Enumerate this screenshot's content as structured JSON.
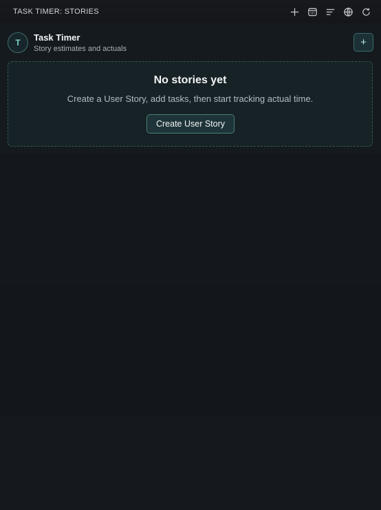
{
  "window": {
    "title": "TASK TIMER: STORIES",
    "toolbar_icons": [
      "plus-icon",
      "calendar-icon",
      "list-icon",
      "globe-icon",
      "refresh-icon"
    ]
  },
  "header": {
    "avatar_letter": "T",
    "title": "Task Timer",
    "subtitle": "Story estimates and actuals",
    "add_label": "+"
  },
  "empty_state": {
    "title": "No stories yet",
    "message": "Create a User Story, add tasks, then start tracking actual time.",
    "button_label": "Create User Story"
  },
  "colors": {
    "accent": "#7fd2c5",
    "background": "#121519",
    "panel": "#172226",
    "border": "#2f5a55"
  }
}
